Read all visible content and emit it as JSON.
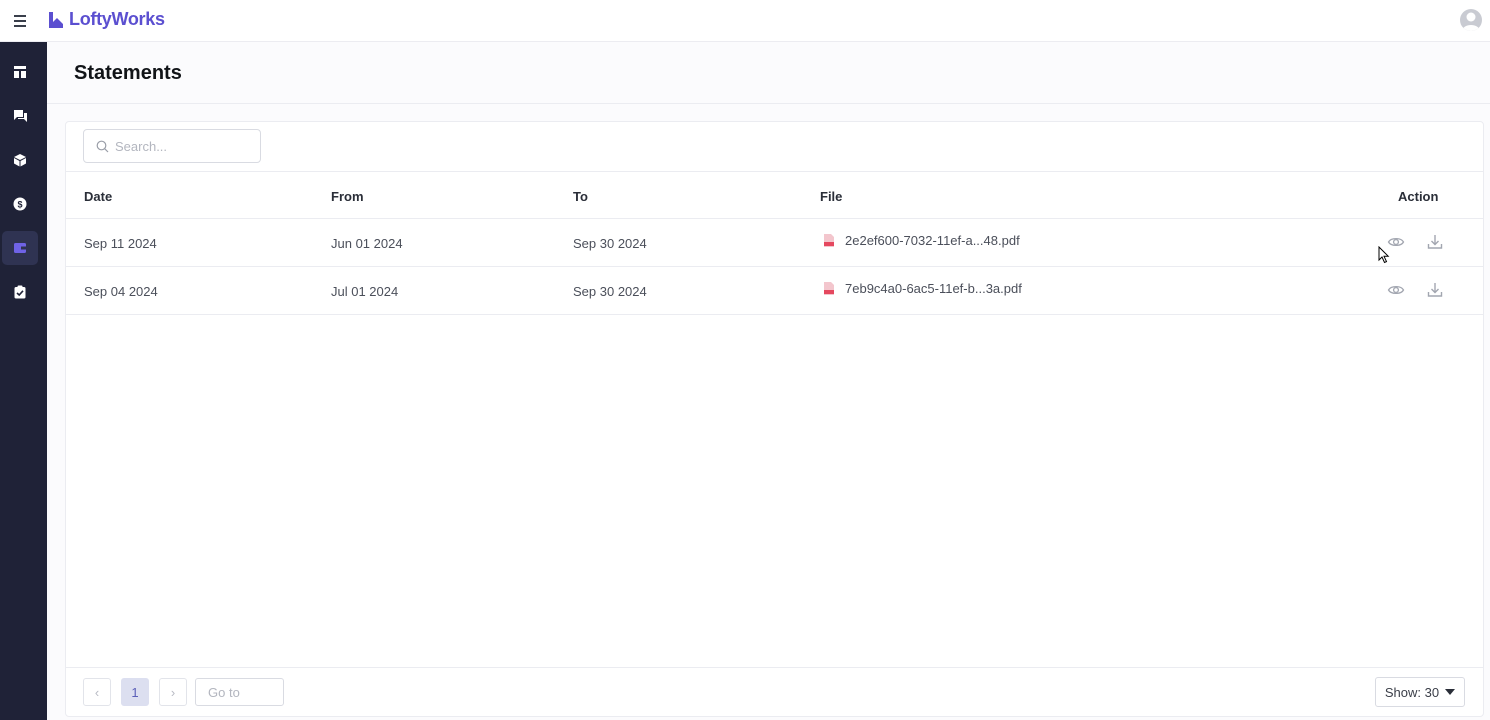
{
  "app": {
    "brand": "LoftyWorks"
  },
  "header": {
    "title": "Statements"
  },
  "sidebar": {
    "items": [
      {
        "icon": "dashboard-icon"
      },
      {
        "icon": "chat-icon"
      },
      {
        "icon": "box-icon"
      },
      {
        "icon": "dollar-icon"
      },
      {
        "icon": "wallet-icon",
        "active": true
      },
      {
        "icon": "clipboard-check-icon"
      }
    ]
  },
  "search": {
    "placeholder": "Search..."
  },
  "table": {
    "columns": {
      "date": "Date",
      "from": "From",
      "to": "To",
      "file": "File",
      "action": "Action"
    },
    "rows": [
      {
        "date": "Sep 11 2024",
        "from": "Jun 01 2024",
        "to": "Sep 30 2024",
        "file": "2e2ef600-7032-11ef-a...48.pdf"
      },
      {
        "date": "Sep 04 2024",
        "from": "Jul 01 2024",
        "to": "Sep 30 2024",
        "file": "7eb9c4a0-6ac5-11ef-b...3a.pdf"
      }
    ]
  },
  "pagination": {
    "prev": "‹",
    "current_page": "1",
    "next": "›",
    "goto_placeholder": "Go to",
    "show_label": "Show: 30"
  },
  "colors": {
    "brand": "#5b4fd0",
    "sidebar_bg": "#1f2237",
    "pdf_red": "#e5485f"
  }
}
